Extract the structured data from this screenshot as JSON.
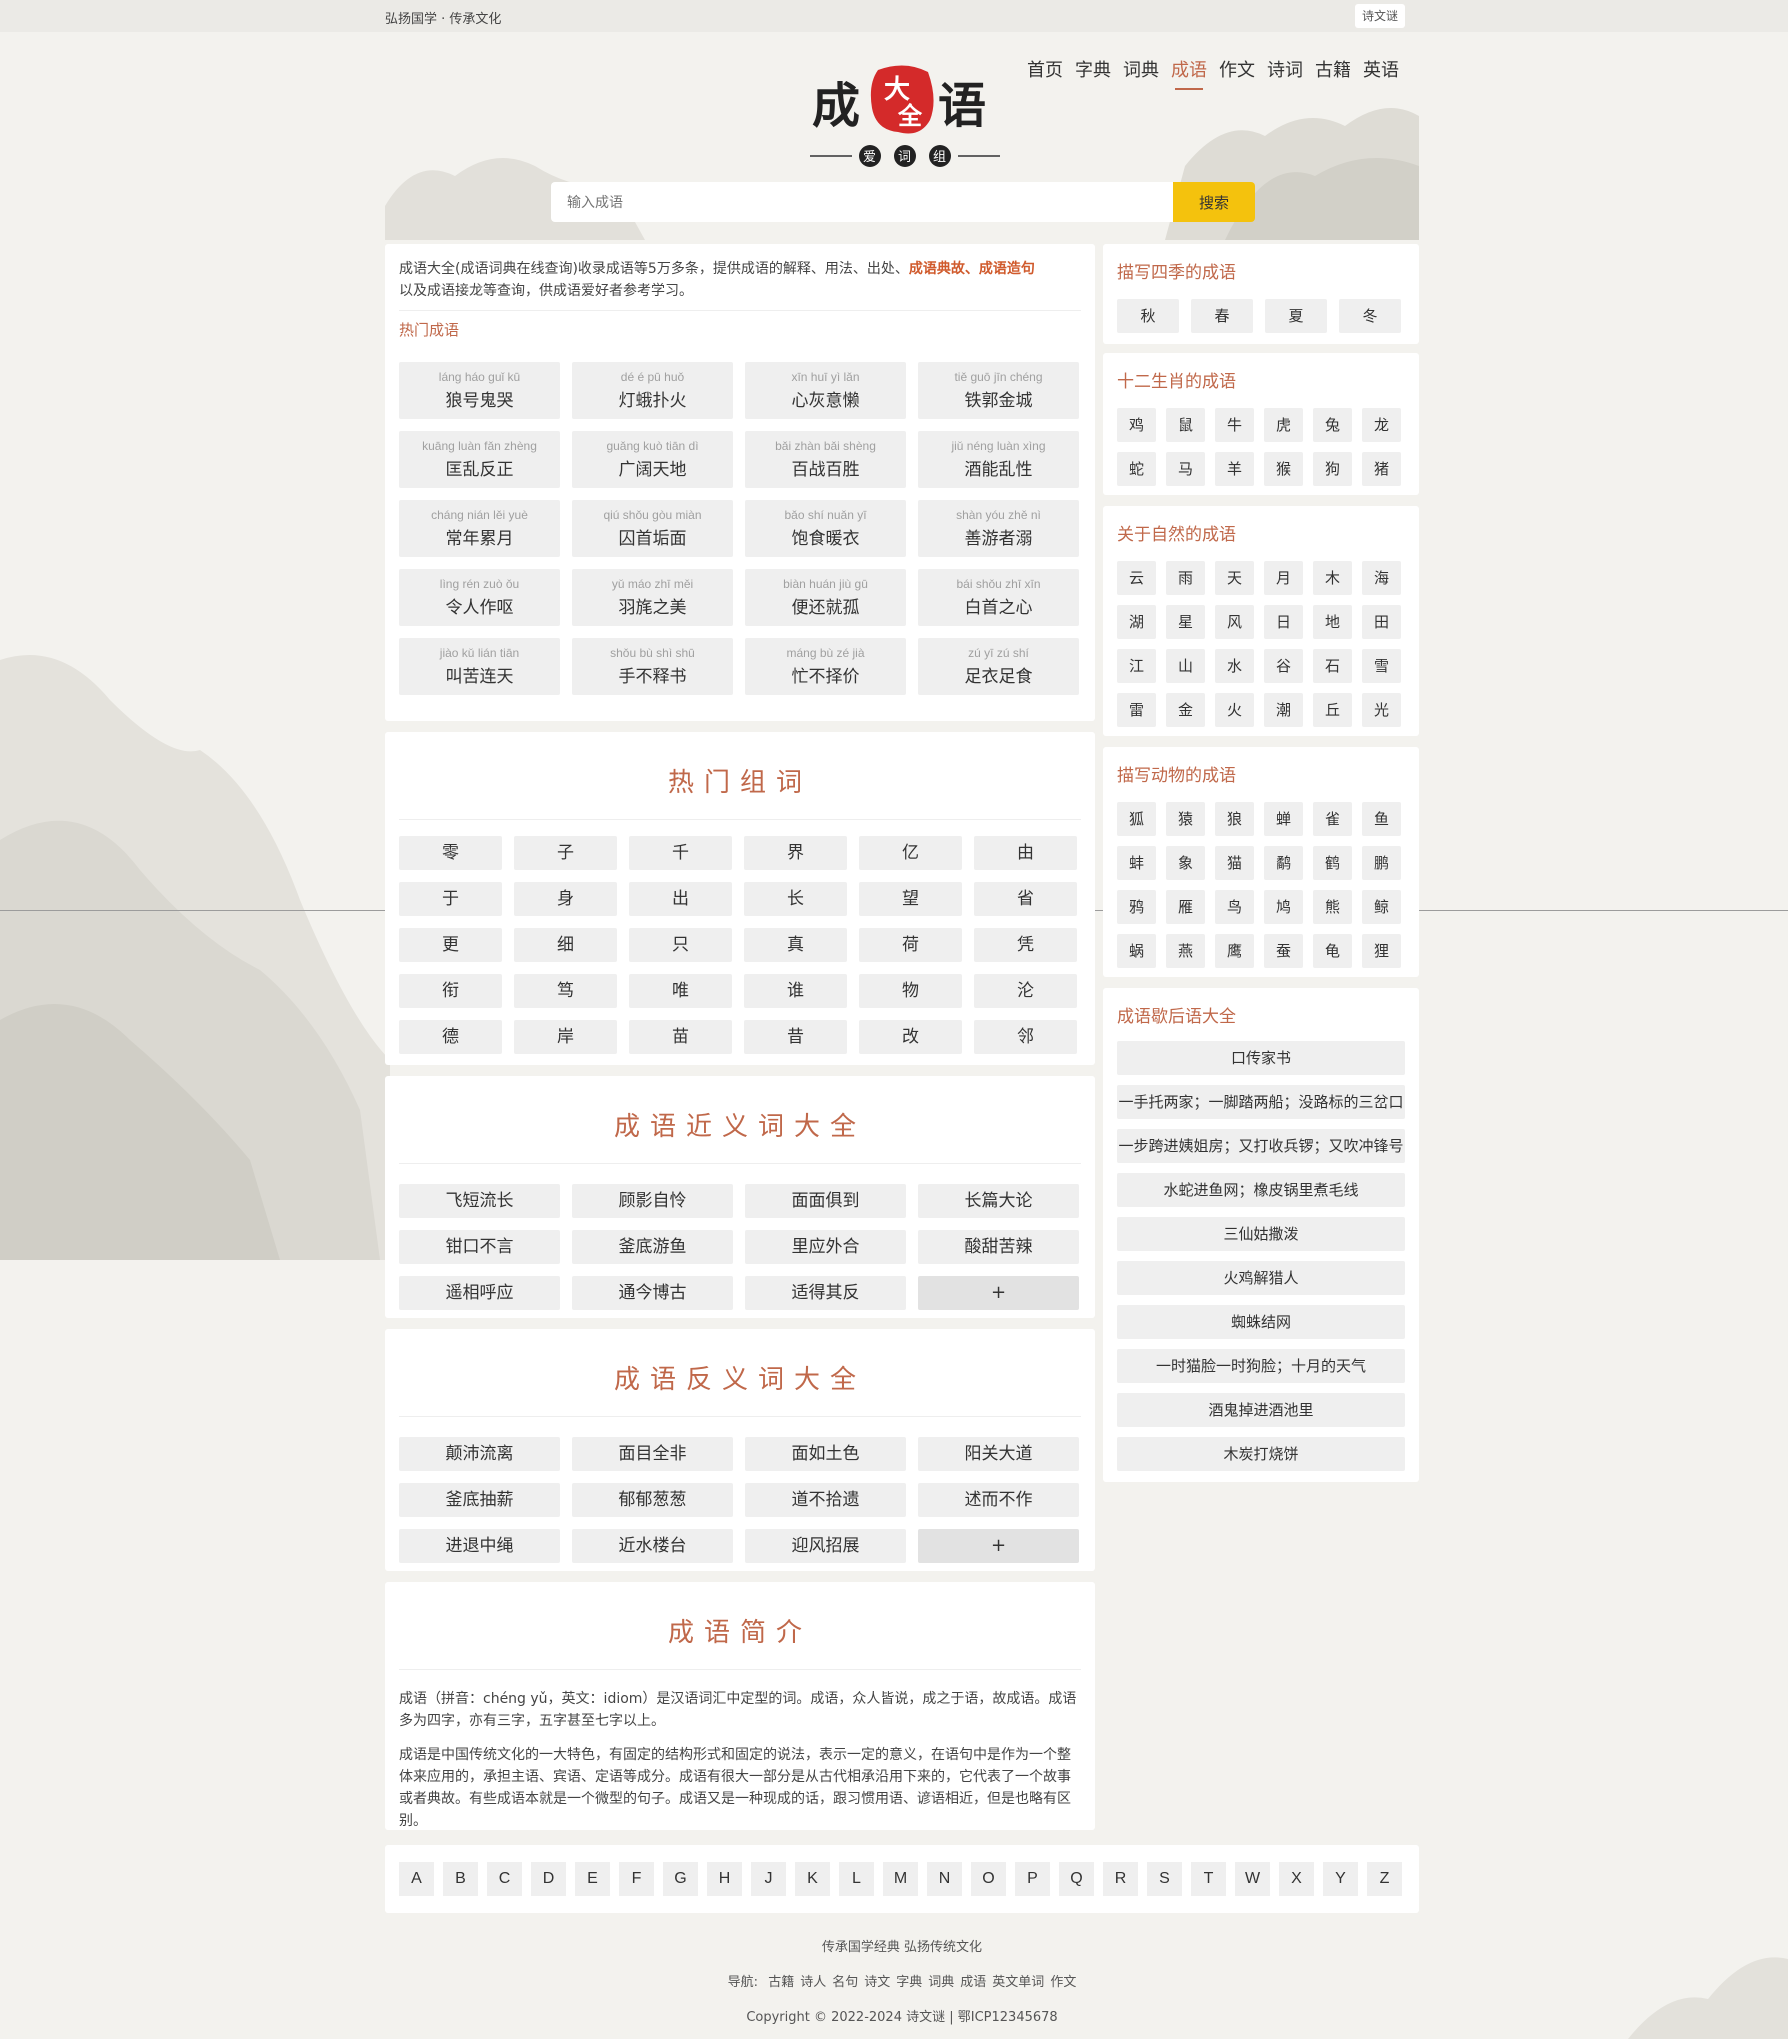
{
  "topbar": {
    "slogan": "弘扬国学 · 传承文化",
    "brand": "诗文谜"
  },
  "nav": [
    "首页",
    "字典",
    "词典",
    "成语",
    "作文",
    "诗词",
    "古籍",
    "英语"
  ],
  "logo": {
    "left": "成",
    "big": "大",
    "full": "全",
    "right": "语",
    "badge1": "爱",
    "badge2": "词",
    "badge3": "组"
  },
  "search": {
    "placeholder": "输入成语",
    "button": "搜索"
  },
  "intro": {
    "text1": "成语大全(成语词典在线查询)收录成语等5万多条，提供成语的解释、用法、出处、",
    "hl1": "成语典故",
    "sep": "、",
    "hl2": "成语造句",
    "text2": "以及成语接龙等查询，供成语爱好者参考学习。",
    "hot_title": "热门成语"
  },
  "hot_idioms": [
    {
      "py": "láng háo guǐ kū",
      "w": "狼号鬼哭"
    },
    {
      "py": "dé é pū huǒ",
      "w": "灯蛾扑火"
    },
    {
      "py": "xīn huī yì lǎn",
      "w": "心灰意懒"
    },
    {
      "py": "tiě guō jīn chéng",
      "w": "铁郭金城"
    },
    {
      "py": "kuāng luàn fǎn zhèng",
      "w": "匡乱反正"
    },
    {
      "py": "guǎng kuò tiān dì",
      "w": "广阔天地"
    },
    {
      "py": "bǎi zhàn bǎi shèng",
      "w": "百战百胜"
    },
    {
      "py": "jiǔ néng luàn xìng",
      "w": "酒能乱性"
    },
    {
      "py": "cháng nián lěi yuè",
      "w": "常年累月"
    },
    {
      "py": "qiú shǒu gòu miàn",
      "w": "囚首垢面"
    },
    {
      "py": "bǎo shí nuǎn yī",
      "w": "饱食暖衣"
    },
    {
      "py": "shàn yóu zhě nì",
      "w": "善游者溺"
    },
    {
      "py": "lìng rén zuò ǒu",
      "w": "令人作呕"
    },
    {
      "py": "yǔ máo zhī měi",
      "w": "羽旄之美"
    },
    {
      "py": "biàn huán jiù gū",
      "w": "便还就孤"
    },
    {
      "py": "bái shǒu zhī xīn",
      "w": "白首之心"
    },
    {
      "py": "jiào kǔ lián tiān",
      "w": "叫苦连天"
    },
    {
      "py": "shǒu bù shì shū",
      "w": "手不释书"
    },
    {
      "py": "máng bù zé jià",
      "w": "忙不择价"
    },
    {
      "py": "zú yī zú shí",
      "w": "足衣足食"
    }
  ],
  "hot_words": {
    "title": "热门组词",
    "items": [
      "零",
      "子",
      "千",
      "界",
      "亿",
      "由",
      "于",
      "身",
      "出",
      "长",
      "望",
      "省",
      "更",
      "细",
      "只",
      "真",
      "荷",
      "凭",
      "衔",
      "笃",
      "唯",
      "谁",
      "物",
      "沦",
      "德",
      "岸",
      "苗",
      "昔",
      "改",
      "邻"
    ]
  },
  "synonyms": {
    "title": "成语近义词大全",
    "items": [
      "飞短流长",
      "顾影自怜",
      "面面俱到",
      "长篇大论",
      "钳口不言",
      "釜底游鱼",
      "里应外合",
      "酸甜苦辣",
      "遥相呼应",
      "通今博古",
      "适得其反"
    ],
    "more": "+"
  },
  "antonyms": {
    "title": "成语反义词大全",
    "items": [
      "颠沛流离",
      "面目全非",
      "面如土色",
      "阳关大道",
      "釜底抽薪",
      "郁郁葱葱",
      "道不拾遗",
      "述而不作",
      "进退中绳",
      "近水楼台",
      "迎风招展"
    ],
    "more": "+"
  },
  "about": {
    "title": "成语简介",
    "p1": "成语（拼音：chéng yǔ，英文：idiom）是汉语词汇中定型的词。成语，众人皆说，成之于语，故成语。成语多为四字，亦有三字，五字甚至七字以上。",
    "p2": "成语是中国传统文化的一大特色，有固定的结构形式和固定的说法，表示一定的意义，在语句中是作为一个整体来应用的，承担主语、宾语、定语等成分。成语有很大一部分是从古代相承沿用下来的，它代表了一个故事或者典故。有些成语本就是一个微型的句子。成语又是一种现成的话，跟习惯用语、谚语相近，但是也略有区别。"
  },
  "seasons": {
    "title": "描写四季的成语",
    "items": [
      "秋",
      "春",
      "夏",
      "冬"
    ]
  },
  "zodiac": {
    "title": "十二生肖的成语",
    "items": [
      "鸡",
      "鼠",
      "牛",
      "虎",
      "兔",
      "龙",
      "蛇",
      "马",
      "羊",
      "猴",
      "狗",
      "猪"
    ]
  },
  "nature": {
    "title": "关于自然的成语",
    "items": [
      "云",
      "雨",
      "天",
      "月",
      "木",
      "海",
      "湖",
      "星",
      "风",
      "日",
      "地",
      "田",
      "江",
      "山",
      "水",
      "谷",
      "石",
      "雪",
      "雷",
      "金",
      "火",
      "潮",
      "丘",
      "光"
    ]
  },
  "animals": {
    "title": "描写动物的成语",
    "items": [
      "狐",
      "猿",
      "狼",
      "蝉",
      "雀",
      "鱼",
      "蚌",
      "象",
      "猫",
      "鹬",
      "鹤",
      "鹏",
      "鸦",
      "雁",
      "鸟",
      "鸠",
      "熊",
      "鲸",
      "蜗",
      "燕",
      "鹰",
      "蚕",
      "龟",
      "狸"
    ]
  },
  "xiehouyu": {
    "title": "成语歇后语大全",
    "items": [
      "口传家书",
      "一手托两家；一脚踏两船；没路标的三岔口",
      "一步跨进姨姐房；又打收兵锣；又吹冲锋号",
      "水蛇进鱼网；橡皮锅里煮毛线",
      "三仙姑撒泼",
      "火鸡解猎人",
      "蜘蛛结网",
      "一时猫脸一时狗脸；十月的天气",
      "酒鬼掉进酒池里",
      "木炭打烧饼"
    ]
  },
  "alphabet": [
    "A",
    "B",
    "C",
    "D",
    "E",
    "F",
    "G",
    "H",
    "J",
    "K",
    "L",
    "M",
    "N",
    "O",
    "P",
    "Q",
    "R",
    "S",
    "T",
    "W",
    "X",
    "Y",
    "Z"
  ],
  "footer": {
    "line1": "传承国学经典 弘扬传统文化",
    "nav_label": "导航:",
    "links": [
      "古籍",
      "诗人",
      "名句",
      "诗文",
      "字典",
      "词典",
      "成语",
      "英文单词",
      "作文"
    ],
    "copyright": "Copyright © 2022-2024 诗文谜 | 鄂ICP12345678"
  },
  "colors": {
    "accent": "#c0684a",
    "search_btn": "#f4c20d",
    "logo_red": "#d42a2a"
  }
}
